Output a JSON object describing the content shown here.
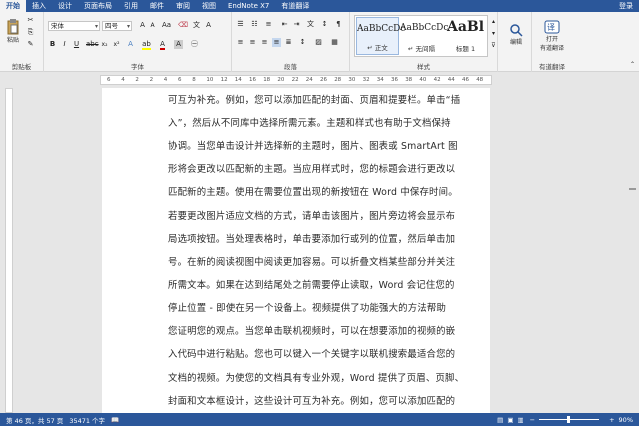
{
  "tabs": [
    "开始",
    "插入",
    "设计",
    "页面布局",
    "引用",
    "邮件",
    "审阅",
    "视图",
    "EndNote X7",
    "有道翻译"
  ],
  "login": "登录",
  "ribbon": {
    "clipboard": {
      "paste": "粘贴",
      "label": "剪贴板"
    },
    "font": {
      "name": "宋体",
      "size": "四号",
      "label": "字体"
    },
    "paragraph": {
      "label": "段落"
    },
    "styles": {
      "label": "样式",
      "items": [
        {
          "preview": "AaBbCcDc",
          "name": "↵ 正文"
        },
        {
          "preview": "AaBbCcDc",
          "name": "↵ 无间隔"
        },
        {
          "preview": "AaBl",
          "name": "标题 1"
        }
      ]
    },
    "edit": {
      "label": "编辑"
    },
    "translate": {
      "open": "打开",
      "open2": "有道翻译",
      "label": "有道翻译"
    }
  },
  "ruler_ticks": [
    "6",
    "4",
    "2",
    "2",
    "4",
    "6",
    "8",
    "10",
    "12",
    "14",
    "16",
    "18",
    "20",
    "22",
    "24",
    "26",
    "28",
    "30",
    "32",
    "34",
    "36",
    "38",
    "40",
    "42",
    "44",
    "46",
    "48"
  ],
  "document": {
    "lines": [
      "可互为补充。例如，您可以添加匹配的封面、页眉和提要栏。单击“插",
      "入”，然后从不同库中选择所需元素。主题和样式也有助于文档保持",
      "协调。当您单击设计并选择新的主题时，图片、图表或 SmartArt 图",
      "形将会更改以匹配新的主题。当应用样式时，您的标题会进行更改以",
      "匹配新的主题。使用在需要位置出现的新按钮在 Word 中保存时间。",
      "若要更改图片适应文档的方式，请单击该图片，图片旁边将会显示布",
      "局选项按钮。当处理表格时，单击要添加行或列的位置，然后单击加",
      "号。在新的阅读视图中阅读更加容易。可以折叠文档某些部分并关注",
      "所需文本。如果在达到结尾处之前需要停止读取，Word 会记住您的",
      "停止位置 - 即使在另一个设备上。视频提供了功能强大的方法帮助",
      "您证明您的观点。当您单击联机视频时，可以在想要添加的视频的嵌",
      "入代码中进行粘贴。您也可以键入一个关键字以联机搜索最适合您的",
      "文档的视频。为使您的文档具有专业外观，Word 提供了页眉、页脚、",
      "封面和文本框设计，这些设计可互为补充。例如，您可以添加匹配的"
    ]
  },
  "status": {
    "page": "第 46 页，共 57 页",
    "words": "35471 个字",
    "zoom": "90%"
  }
}
